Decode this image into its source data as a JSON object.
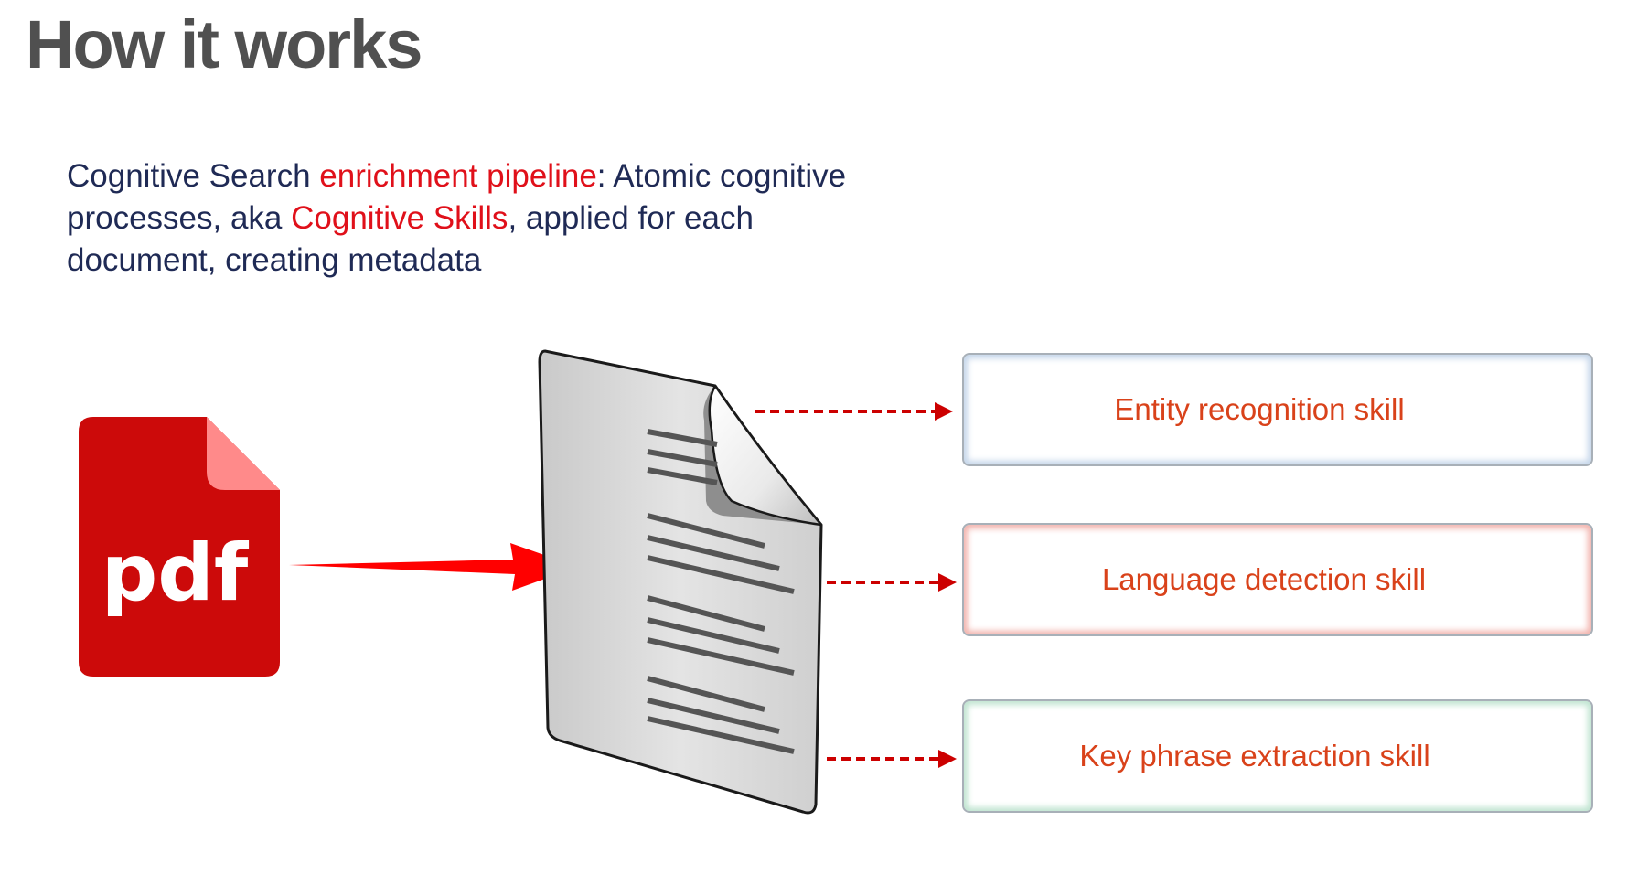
{
  "title": "How it works",
  "intro": {
    "t1": "Cognitive Search ",
    "h1": "enrichment pipeline",
    "t2": ": Atomic cognitive processes, aka ",
    "h2": "Cognitive Skills",
    "t3": ", applied for each document, creating metadata"
  },
  "pdf_icon": {
    "label": "pdf"
  },
  "skills": [
    {
      "label": "Entity recognition skill"
    },
    {
      "label": "Language detection skill"
    },
    {
      "label": "Key phrase extraction skill"
    }
  ],
  "colors": {
    "title": "#505050",
    "intro_text": "#1f2a55",
    "highlight": "#e0101a",
    "pdf_red": "#cc0a0a",
    "pdf_fold": "#ff8a8a",
    "arrow_red": "#ff0000",
    "dashed_arrow": "#cc0000",
    "skill_text": "#d9421a"
  }
}
